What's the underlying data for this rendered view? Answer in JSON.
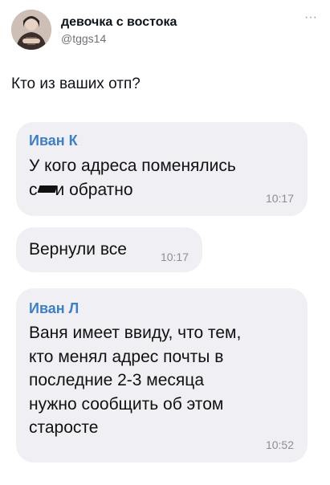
{
  "author": {
    "display_name": "девочка с востока",
    "handle": "@tggs14"
  },
  "more_icon": "more-icon",
  "tweet_text": "Кто из ваших отп?",
  "messages": [
    {
      "sender": "Иван К",
      "lines": [
        "У кого адреса поменялись",
        "и обратно"
      ],
      "censor_prefix": "с",
      "time": "10:17"
    },
    {
      "sender": "",
      "lines": [
        "Вернули все"
      ],
      "time": "10:17"
    },
    {
      "sender": "Иван Л",
      "lines": [
        "Ваня имеет ввиду, что тем,",
        "кто менял адрес почты в",
        "последние 2-3 месяца",
        "нужно сообщить об этом",
        "старосте"
      ],
      "time": "10:52"
    }
  ],
  "colors": {
    "bubble": "#efeff4",
    "sender": "#3f7fc2",
    "time": "#8b8f94",
    "handle": "#6d7278"
  }
}
